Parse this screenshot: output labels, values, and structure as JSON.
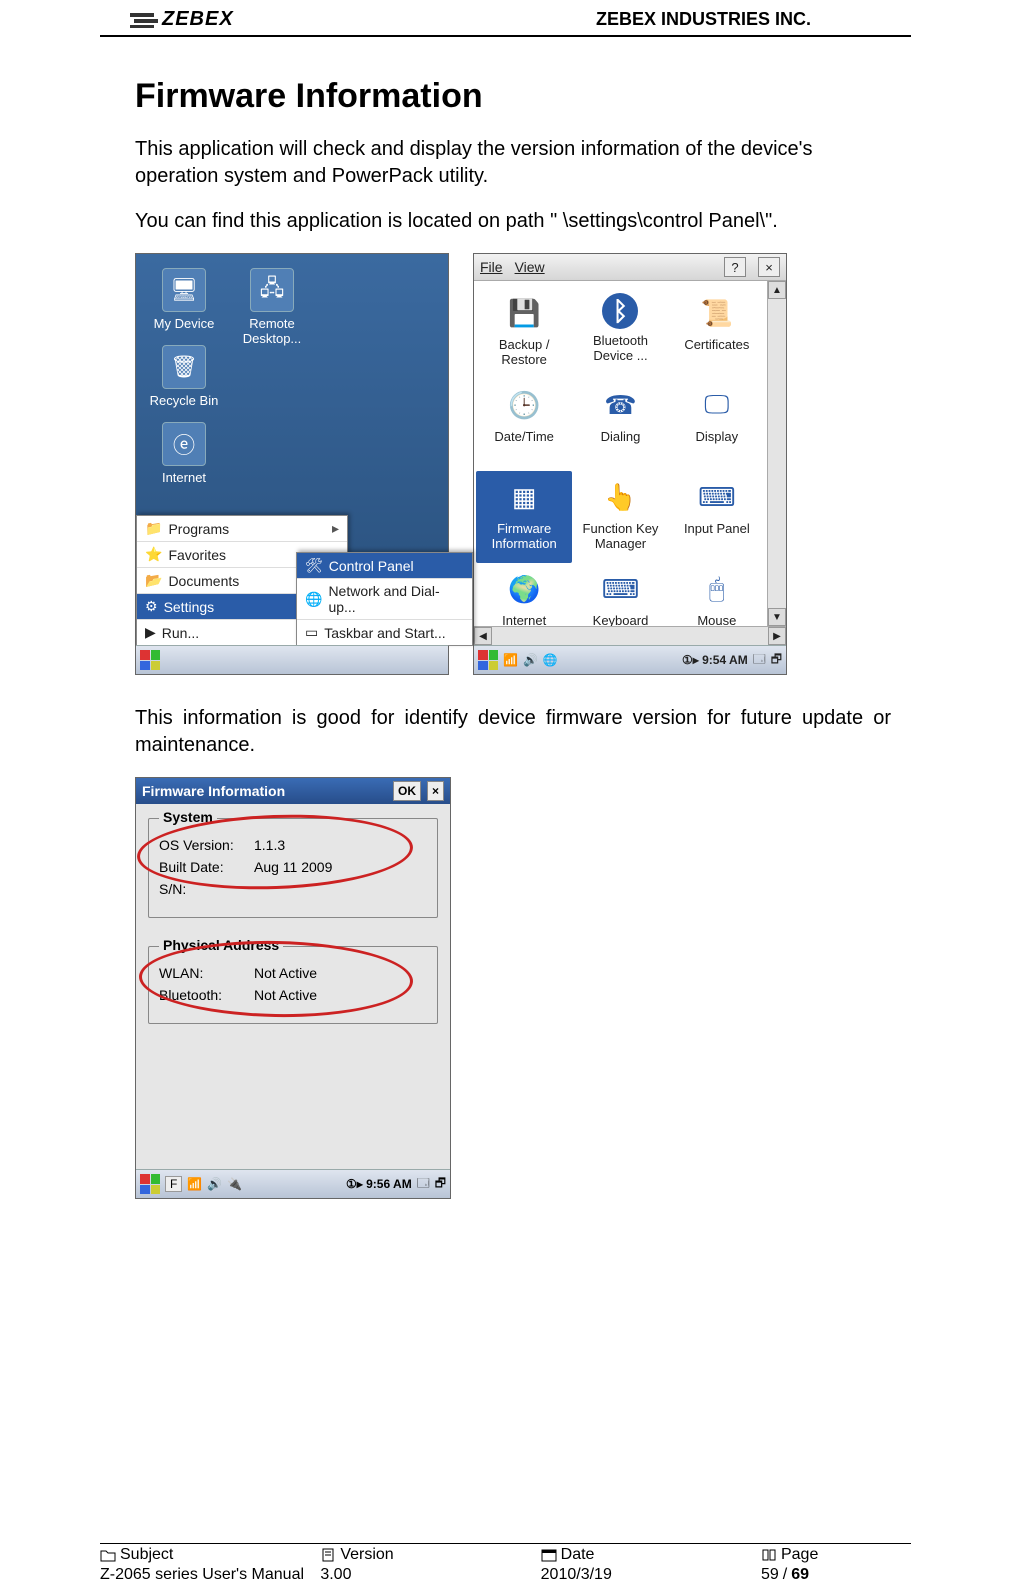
{
  "header": {
    "brand": "ZEBEX",
    "company": "ZEBEX INDUSTRIES INC."
  },
  "doc": {
    "title": "Firmware Information",
    "p1": "This application will check and display the version information of the device's operation system and PowerPack utility.",
    "p2": "You can find this application is located on path \" \\settings\\control Panel\\\".",
    "p3": "This information is good for identify device firmware version for future update or maintenance."
  },
  "shot1": {
    "desktop_icons": {
      "my_device": "My Device",
      "remote_desktop": "Remote Desktop...",
      "recycle_bin": "Recycle Bin",
      "internet": "Internet"
    },
    "start_menu": {
      "programs": "Programs",
      "favorites": "Favorites",
      "documents": "Documents",
      "settings": "Settings",
      "run": "Run..."
    },
    "submenu": {
      "control_panel": "Control Panel",
      "network": "Network and Dial-up...",
      "taskbar": "Taskbar and Start..."
    }
  },
  "shot2": {
    "menu_file": "File",
    "menu_view": "View",
    "help": "?",
    "close": "×",
    "items": {
      "backup": "Backup / Restore",
      "bluetooth": "Bluetooth Device ...",
      "certificates": "Certificates",
      "datetime": "Date/Time",
      "dialing": "Dialing",
      "display": "Display",
      "firmware": "Firmware Information",
      "funckey": "Function Key Manager",
      "inputpanel": "Input Panel",
      "internet": "Internet",
      "keyboard": "Keyboard",
      "mouse": "Mouse"
    },
    "time": "9:54 AM",
    "time_prefix": "①▸"
  },
  "shot3": {
    "title": "Firmware Information",
    "ok": "OK",
    "close": "×",
    "system": {
      "legend": "System",
      "os_label": "OS Version:",
      "os_val": "1.1.3",
      "built_label": "Built Date:",
      "built_val": "Aug 11 2009",
      "sn_label": "S/N:"
    },
    "physical": {
      "legend": "Physical Address",
      "wlan_label": "WLAN:",
      "wlan_val": "Not Active",
      "bt_label": "Bluetooth:",
      "bt_val": "Not Active"
    },
    "time": "9:56 AM",
    "tb_item": "F"
  },
  "footer": {
    "subject_label": "Subject",
    "subject_val": "Z-2065 series User's Manual",
    "version_label": "Version",
    "version_val": "3.00",
    "date_label": "Date",
    "date_val": "2010/3/19",
    "page_label": "Page",
    "page_cur": "59",
    "page_sep": " / ",
    "page_total": "69"
  }
}
